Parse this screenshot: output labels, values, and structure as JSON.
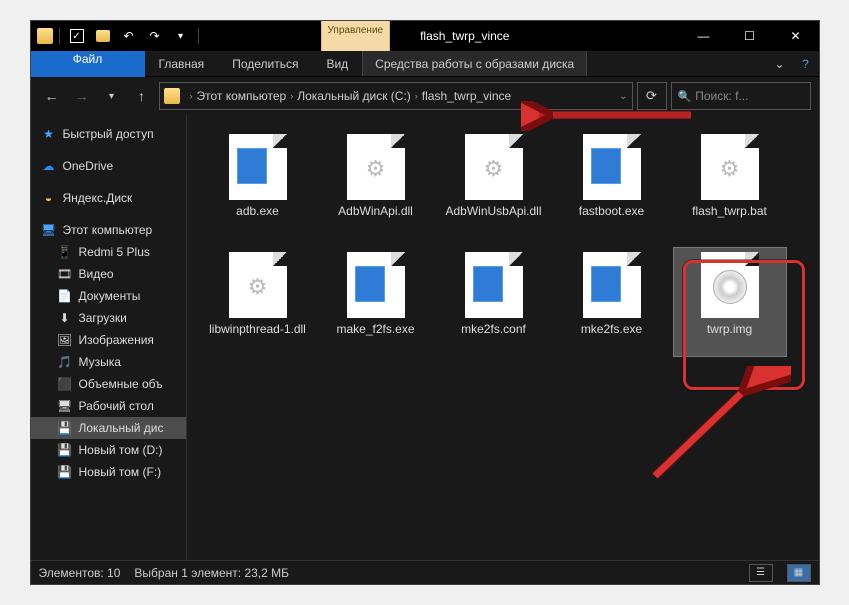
{
  "titlebar": {
    "manage_label": "Управление",
    "window_title": "flash_twrp_vince"
  },
  "ribbon": {
    "file": "Файл",
    "home": "Главная",
    "share": "Поделиться",
    "view": "Вид",
    "disk_tools": "Средства работы с образами диска"
  },
  "breadcrumb": {
    "root": "Этот компьютер",
    "drive": "Локальный диск (C:)",
    "folder": "flash_twrp_vince"
  },
  "search": {
    "placeholder": "Поиск: f..."
  },
  "sidebar": {
    "quick": "Быстрый доступ",
    "onedrive": "OneDrive",
    "yandex": "Яндекс.Диск",
    "thispc": "Этот компьютер",
    "items": [
      "Redmi 5 Plus",
      "Видео",
      "Документы",
      "Загрузки",
      "Изображения",
      "Музыка",
      "Объемные объ",
      "Рабочий стол",
      "Локальный дис",
      "Новый том (D:)",
      "Новый том (F:)"
    ]
  },
  "files": [
    {
      "name": "adb.exe",
      "kind": "blue"
    },
    {
      "name": "AdbWinApi.dll",
      "kind": "gear"
    },
    {
      "name": "AdbWinUsbApi.dll",
      "kind": "gear"
    },
    {
      "name": "fastboot.exe",
      "kind": "blue"
    },
    {
      "name": "flash_twrp.bat",
      "kind": "gear"
    },
    {
      "name": "libwinpthread-1.dll",
      "kind": "gear"
    },
    {
      "name": "make_f2fs.exe",
      "kind": "blue"
    },
    {
      "name": "mke2fs.conf",
      "kind": "blue"
    },
    {
      "name": "mke2fs.exe",
      "kind": "blue"
    },
    {
      "name": "twrp.img",
      "kind": "disc",
      "selected": true
    }
  ],
  "status": {
    "count": "Элементов: 10",
    "selection": "Выбран 1 элемент: 23,2 МБ"
  }
}
